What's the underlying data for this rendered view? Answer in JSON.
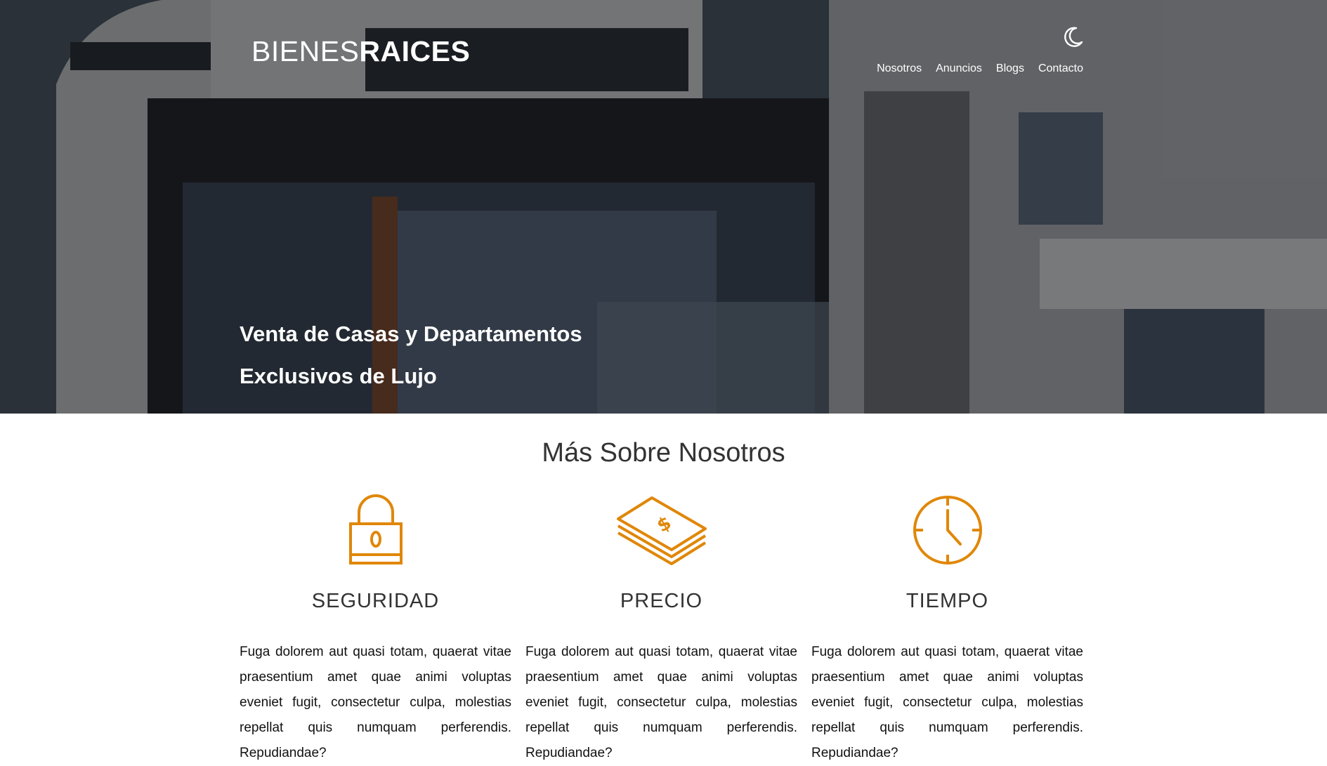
{
  "header": {
    "logo_light": "BIENES",
    "logo_bold": "RAICES",
    "nav": [
      "Nosotros",
      "Anuncios",
      "Blogs",
      "Contacto"
    ],
    "dark_mode_icon": "moon-icon"
  },
  "hero": {
    "title_line1": "Venta de Casas y Departamentos",
    "title_line2": "Exclusivos de Lujo"
  },
  "about": {
    "title": "Más Sobre Nosotros",
    "accent_color": "#E08709",
    "features": [
      {
        "icon": "lock-icon",
        "title": "SEGURIDAD",
        "text": "Fuga dolorem aut quasi totam, quaerat vitae praesentium amet quae animi voluptas eveniet fugit, consectetur culpa, molestias repellat quis numquam perferendis. Repudiandae?"
      },
      {
        "icon": "money-icon",
        "title": "PRECIO",
        "text": "Fuga dolorem aut quasi totam, quaerat vitae praesentium amet quae animi voluptas eveniet fugit, consectetur culpa, molestias repellat quis numquam perferendis. Repudiandae?"
      },
      {
        "icon": "clock-icon",
        "title": "TIEMPO",
        "text": "Fuga dolorem aut quasi totam, quaerat vitae praesentium amet quae animi voluptas eveniet fugit, consectetur culpa, molestias repellat quis numquam perferendis. Repudiandae?"
      }
    ]
  }
}
